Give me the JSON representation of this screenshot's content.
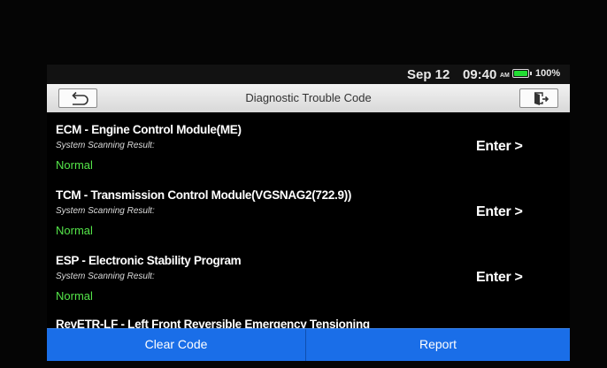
{
  "statusbar": {
    "date": "Sep 12",
    "time": "09:40",
    "ampm": "AM",
    "battery": "100%",
    "battery_level": 1.0
  },
  "titlebar": {
    "title": "Diagnostic Trouble Code",
    "back_icon": "back-arrow-icon",
    "exit_icon": "exit-door-icon"
  },
  "modules": [
    {
      "name": "ECM - Engine Control Module(ME)",
      "result_label": "System Scanning Result:",
      "result": "Normal",
      "action": "Enter >"
    },
    {
      "name": "TCM - Transmission Control Module(VGSNAG2(722.9))",
      "result_label": "System Scanning Result:",
      "result": "Normal",
      "action": "Enter >"
    },
    {
      "name": "ESP - Electronic Stability Program",
      "result_label": "System Scanning Result:",
      "result": "Normal",
      "action": "Enter >"
    },
    {
      "name": "RevETR-LF - Left Front Reversible Emergency Tensioning"
    }
  ],
  "footer": {
    "clear_label": "Clear Code",
    "report_label": "Report"
  },
  "colors": {
    "accent": "#1a6ee8",
    "normal": "#55e64a",
    "battery": "#22dd33"
  }
}
